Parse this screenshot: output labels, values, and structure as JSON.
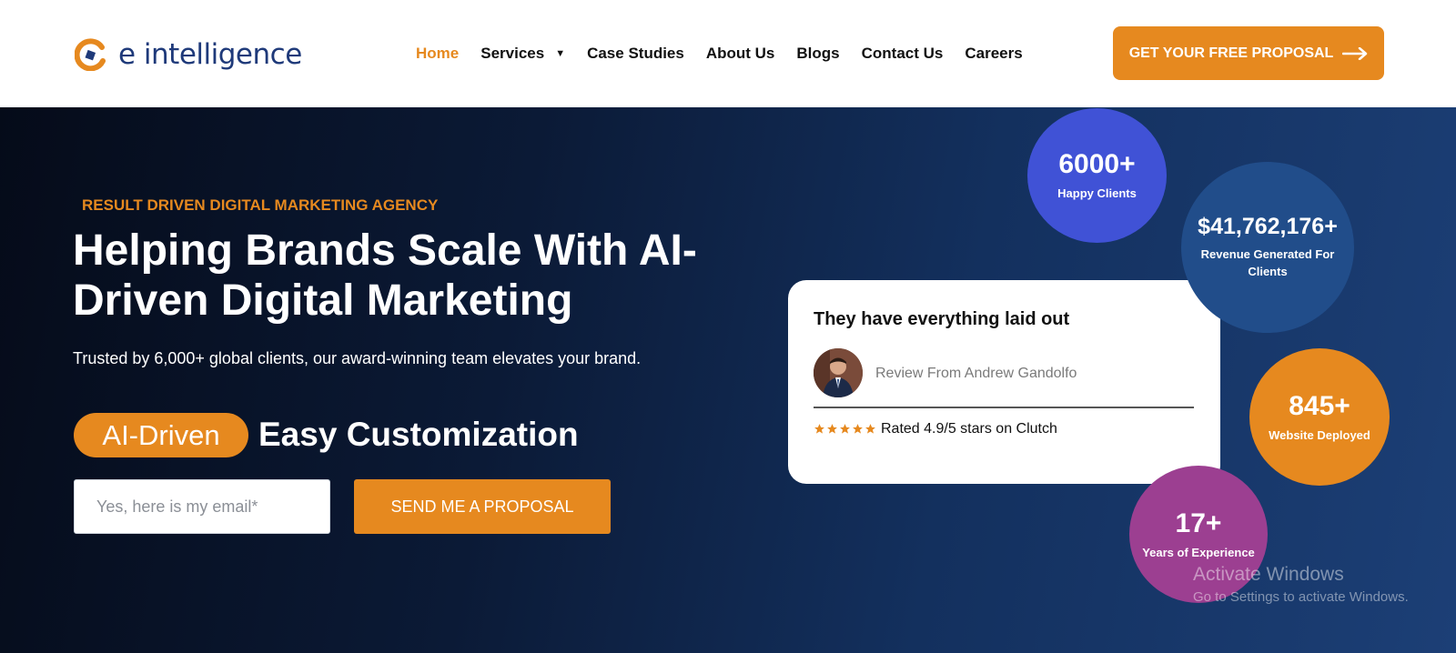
{
  "header": {
    "logo_text": "e intelligence",
    "nav": [
      {
        "label": "Home",
        "active": true
      },
      {
        "label": "Services",
        "has_dropdown": true
      },
      {
        "label": "Case Studies"
      },
      {
        "label": "About Us"
      },
      {
        "label": "Blogs"
      },
      {
        "label": "Contact Us"
      },
      {
        "label": "Careers"
      }
    ],
    "cta_label": "GET YOUR FREE PROPOSAL"
  },
  "hero": {
    "eyebrow": "RESULT DRIVEN DIGITAL MARKETING AGENCY",
    "headline": "Helping Brands Scale With AI-Driven Digital Marketing",
    "subtext": "Trusted by 6,000+ global clients, our award-winning team elevates your brand.",
    "pill_label": "AI-Driven",
    "rotating_text": "Easy Customization",
    "email_placeholder": "Yes, here is my email*",
    "send_button": "SEND ME A PROPOSAL"
  },
  "review_card": {
    "title": "They have everything laid out",
    "reviewer": "Review From Andrew Gandolfo",
    "rating_text": "Rated 4.9/5 stars on Clutch",
    "stars": 5
  },
  "stats": [
    {
      "value": "6000+",
      "label": "Happy Clients"
    },
    {
      "value": "$41,762,176+",
      "label": "Revenue Generated For Clients"
    },
    {
      "value": "845+",
      "label": "Website Deployed"
    },
    {
      "value": "17+",
      "label": "Years of Experience"
    }
  ],
  "watermark": {
    "title": "Activate Windows",
    "subtitle": "Go to Settings to activate Windows."
  },
  "colors": {
    "accent": "#e6891f",
    "brand_blue": "#1f3a7a",
    "stat_blue": "#4052d6",
    "stat_navy": "#214d8a",
    "stat_purple": "#9c3f91"
  }
}
